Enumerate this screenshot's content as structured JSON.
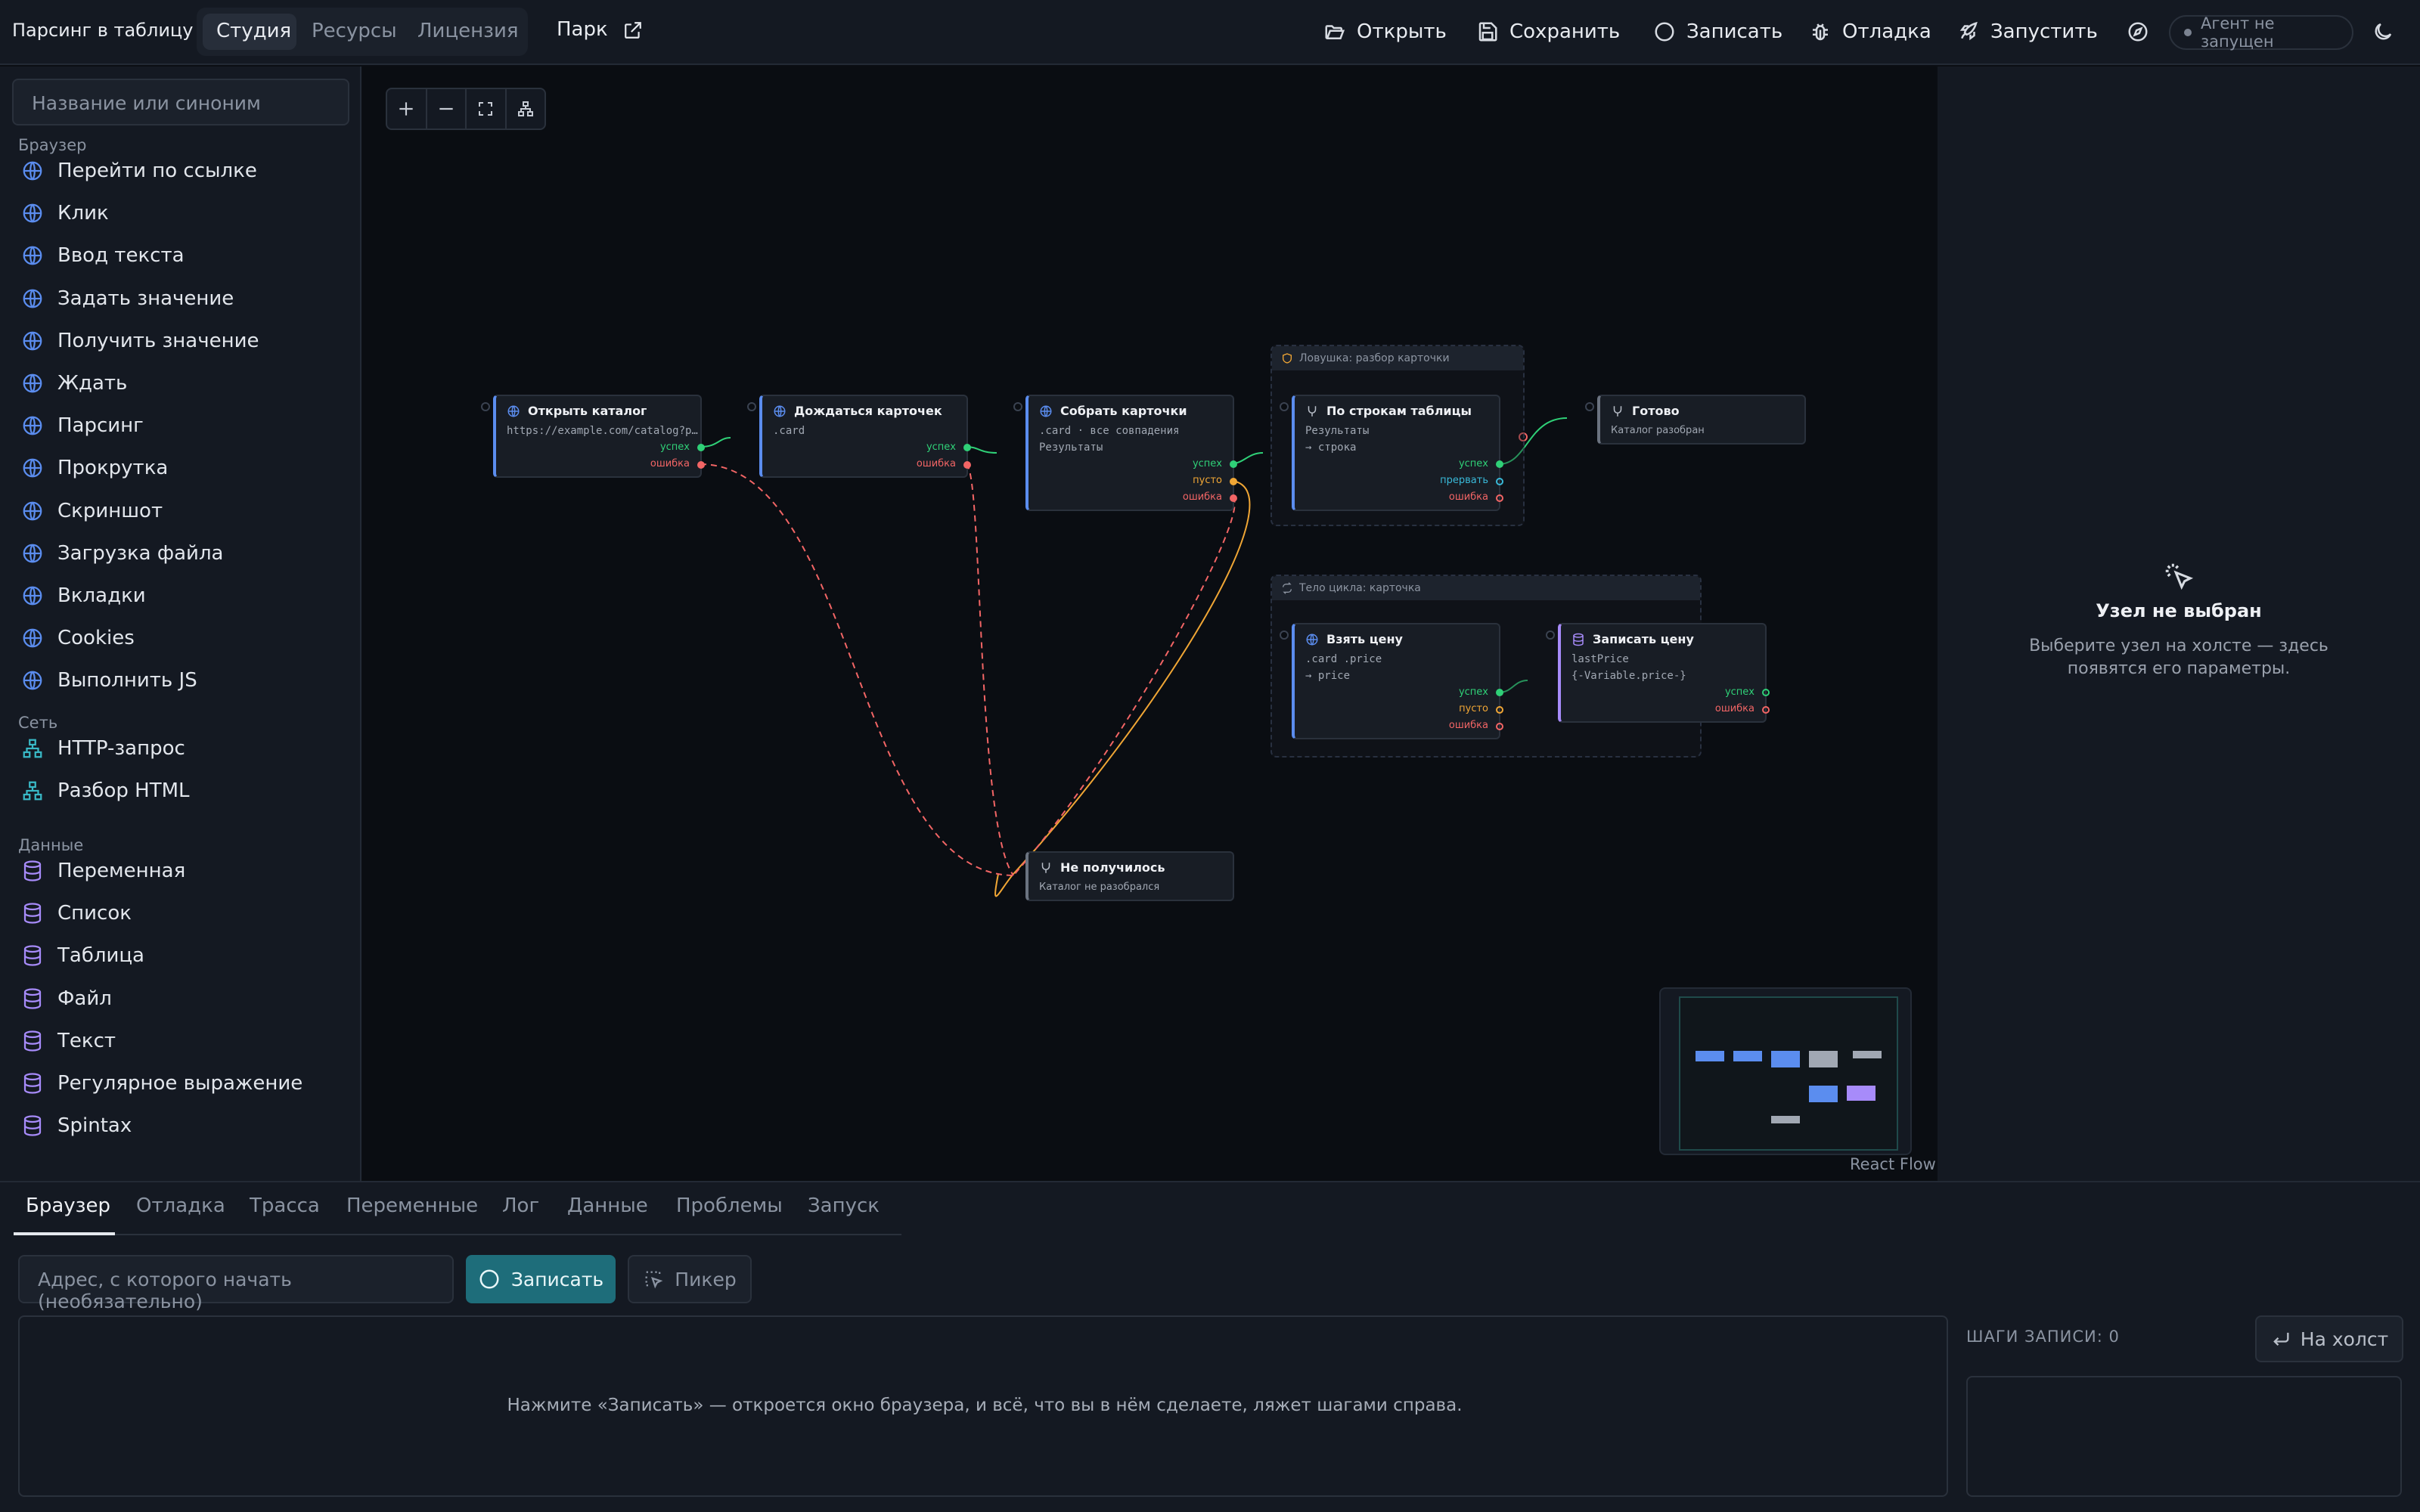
{
  "header": {
    "app_title": "Парсинг в таблицу",
    "tabs": [
      "Студия",
      "Ресурсы",
      "Лицензия"
    ],
    "park": "Парк",
    "actions": [
      "Открыть",
      "Сохранить",
      "Записать",
      "Отладка",
      "Запустить"
    ],
    "agent_status": "Агент не запущен"
  },
  "sidebar": {
    "search_placeholder": "Название или синоним",
    "categories": [
      {
        "name": "Браузер",
        "items": [
          "Перейти по ссылке",
          "Клик",
          "Ввод текста",
          "Задать значение",
          "Получить значение",
          "Ждать",
          "Парсинг",
          "Прокрутка",
          "Скриншот",
          "Загрузка файла",
          "Вкладки",
          "Cookies",
          "Выполнить JS"
        ]
      },
      {
        "name": "Сеть",
        "items": [
          "HTTP-запрос",
          "Разбор HTML"
        ]
      },
      {
        "name": "Данные",
        "items": [
          "Переменная",
          "Список",
          "Таблица",
          "Файл",
          "Текст",
          "Регулярное выражение",
          "Spintax"
        ]
      }
    ],
    "icon_colors": {
      "browser": "#5b8def",
      "network": "#39b9c6",
      "data": "#a78bfa"
    }
  },
  "canvas": {
    "groups": {
      "trap": "Ловушка: разбор карточки",
      "loop": "Тело цикла: карточка"
    },
    "nodes": {
      "open_catalog": {
        "title": "Открыть каталог",
        "line1": "https://example.com/catalog?p…"
      },
      "wait_cards": {
        "title": "Дождаться карточек",
        "line1": ".card"
      },
      "collect_cards": {
        "title": "Собрать карточки",
        "line1": ".card · все совпадения",
        "line2": "Результаты"
      },
      "by_rows": {
        "title": "По строкам таблицы",
        "line1": "Результаты",
        "line2": "→ строка"
      },
      "done": {
        "title": "Готово",
        "line1": "Каталог разобран"
      },
      "take_price": {
        "title": "Взять цену",
        "line1": ".card .price",
        "line2": "→ price"
      },
      "write_price": {
        "title": "Записать цену",
        "line1": "lastPrice",
        "line2": "{-Variable.price-}"
      },
      "failed": {
        "title": "Не получилось",
        "line1": "Каталог не разобрался"
      }
    },
    "ports": {
      "ok": "успех",
      "err": "ошибка",
      "empty": "пусто",
      "break": "прервать"
    },
    "port_colors": {
      "ok": "#2fd077",
      "empty": "#f0a635",
      "err": "#f26565",
      "break": "#39b9d8"
    },
    "react_flow_label": "React Flow"
  },
  "inspector": {
    "title": "Узел не выбран",
    "text": "Выберите узел на холсте — здесь появятся его параметры."
  },
  "bottom": {
    "tabs": [
      "Браузер",
      "Отладка",
      "Трасса",
      "Переменные",
      "Лог",
      "Данные",
      "Проблемы",
      "Запуск"
    ],
    "url_placeholder": "Адрес, с которого начать (необязательно)",
    "record_button": "Записать",
    "picker_button": "Пикер",
    "hint": "Нажмите «Записать» — откроется окно браузера, и всё, что вы в нём сделаете, ляжет шагами справа.",
    "steps_label": "ШАГИ ЗАПИСИ: 0",
    "to_canvas": "На холст"
  }
}
